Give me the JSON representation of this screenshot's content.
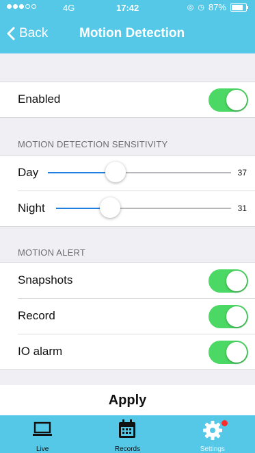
{
  "status_bar": {
    "carrier": "4G",
    "time": "17:42",
    "battery": "87%",
    "battery_level": 0.87,
    "icons": [
      "signal-dots-icon",
      "location-icon",
      "alarm-icon",
      "battery-icon"
    ]
  },
  "nav": {
    "back_label": "Back",
    "title": "Motion Detection"
  },
  "enabled_row": {
    "label": "Enabled",
    "on": true
  },
  "sensitivity": {
    "header": "MOTION DETECTION SENSITIVITY",
    "day": {
      "label": "Day",
      "value": "37",
      "fraction": 0.37
    },
    "night": {
      "label": "Night",
      "value": "31",
      "fraction": 0.31
    }
  },
  "alert": {
    "header": "MOTION ALERT",
    "items": [
      {
        "label": "Snapshots",
        "on": true
      },
      {
        "label": "Record",
        "on": true
      },
      {
        "label": "IO alarm",
        "on": true
      }
    ]
  },
  "apply_label": "Apply",
  "tabs": [
    {
      "label": "Live",
      "icon": "laptop-icon",
      "active": false
    },
    {
      "label": "Records",
      "icon": "calendar-icon",
      "active": false
    },
    {
      "label": "Settings",
      "icon": "gear-icon",
      "active": true,
      "badge": true
    }
  ],
  "colors": {
    "accent": "#55c8e8",
    "toggle_on": "#4cd864",
    "slider_fill": "#1f7fe0",
    "badge": "#ff2a2a",
    "background": "#efeff4"
  }
}
